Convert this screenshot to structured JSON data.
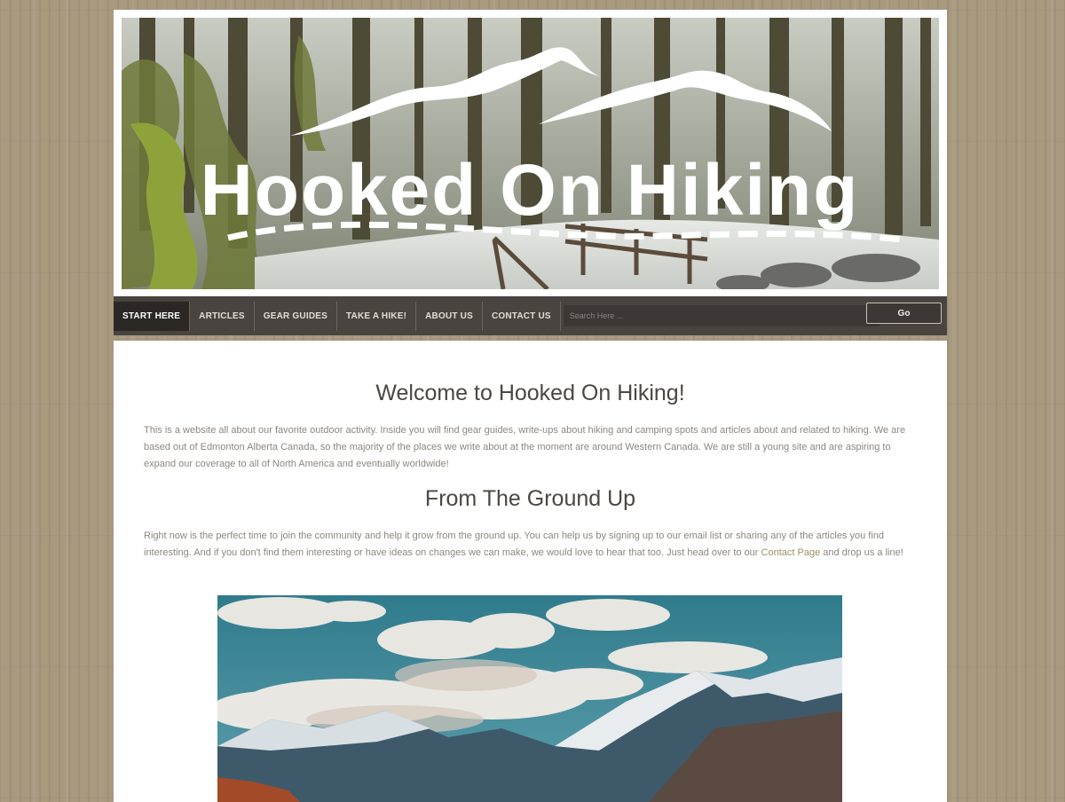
{
  "site": {
    "logo_text": "Hooked On Hiking"
  },
  "nav": {
    "items": [
      {
        "label": "START HERE"
      },
      {
        "label": "ARTICLES"
      },
      {
        "label": "GEAR GUIDES"
      },
      {
        "label": "TAKE A HIKE!"
      },
      {
        "label": "ABOUT US"
      },
      {
        "label": "CONTACT US"
      }
    ],
    "search_placeholder": "Search Here ...",
    "go_label": "Go"
  },
  "main": {
    "heading1": "Welcome to Hooked On Hiking!",
    "para1": "This is a website all about our favorite outdoor activity. Inside you will find gear guides, write-ups about hiking and camping spots and articles about and related to hiking. We are based out of Edmonton Alberta Canada, so the majority of the places we write about at the moment are around Western Canada. We are still a young site and are aspiring to expand our coverage to all of North America and eventually worldwide!",
    "heading2": "From The Ground Up",
    "para2_before": "Right now is the perfect time to join the community and help it grow from the ground up. You can help us by signing up to our email list or sharing any of the articles you find interesting. And if you don't find them interesting or have ideas on changes we can make, we would love to hear that too. Just head over to our ",
    "para2_link": "Contact Page",
    "para2_after": " and drop us a line!"
  },
  "colors": {
    "nav_bg": "#4a4440",
    "nav_active": "#2b2724",
    "link": "#9a8f66",
    "body_text": "#8c8680"
  }
}
